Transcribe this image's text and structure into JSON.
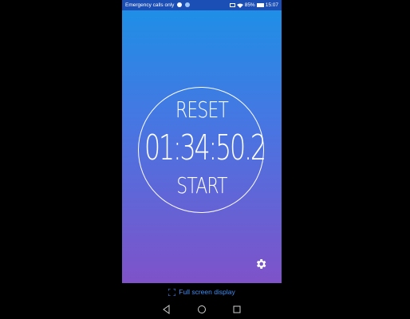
{
  "status_bar": {
    "carrier_text": "Emergency calls only",
    "battery": "85%",
    "time": "15:07",
    "icons": [
      "notification-icon",
      "vibrate-icon",
      "wifi-icon",
      "battery-icon"
    ]
  },
  "stopwatch": {
    "reset_label": "RESET",
    "time": "01:34:50.2",
    "start_label": "START"
  },
  "settings": {
    "icon": "gear-icon"
  },
  "fullscreen": {
    "label": "Full screen display",
    "icon": "expand-icon"
  },
  "navbar": {
    "back": "back-icon",
    "home": "home-icon",
    "recents": "recents-icon"
  },
  "colors": {
    "gradient_top": "#1f8fe6",
    "gradient_bottom": "#7f52c9",
    "status_bar": "#1b4fb6",
    "link": "#3e8ef7"
  }
}
